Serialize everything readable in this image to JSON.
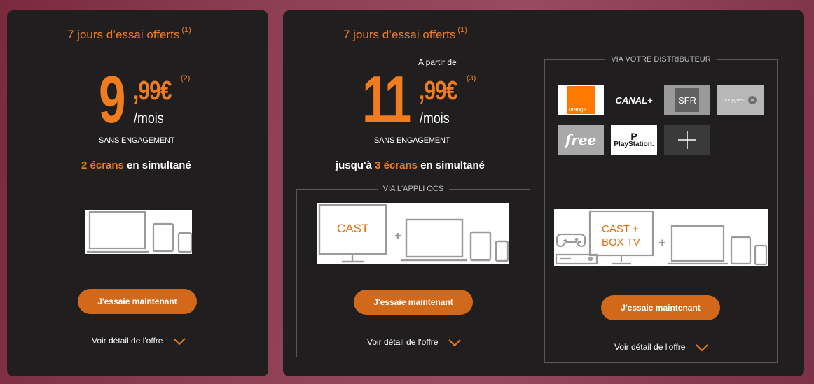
{
  "colors": {
    "accent": "#ef7d20",
    "button": "#d2691a",
    "card": "#201e1f"
  },
  "offer1": {
    "trial": "7 jours d’essai offerts",
    "trial_note": "(1)",
    "price_int": "9",
    "price_cents": ",99€",
    "price_note": "(2)",
    "per_month": "/mois",
    "commitment": "SANS ENGAGEMENT",
    "screens_highlight": "2 écrans",
    "screens_rest": " en simultané",
    "button": "J'essaie maintenant",
    "detail": "Voir détail de l'offre"
  },
  "offer2": {
    "trial": "7 jours d’essai offerts",
    "trial_note": "(1)",
    "from": "A partir de",
    "price_int": "11",
    "price_cents": ",99€",
    "price_note": "(3)",
    "per_month": "/mois",
    "commitment": "SANS ENGAGEMENT",
    "screens_prefix": "jusqu'à ",
    "screens_highlight": "3 écrans",
    "screens_rest": " en simultané",
    "app_group": {
      "label": "VIA L'APPLI OCS",
      "cast_label": "CAST",
      "button": "J'essaie maintenant",
      "detail": "Voir détail de l'offre"
    },
    "distributor_group": {
      "label": "VIA VOTRE DISTRIBUTEUR",
      "logos": {
        "orange": "orange",
        "canal": "CANAL+",
        "sfr": "SFR",
        "bouygues": "bouygues",
        "free": "free",
        "playstation": "PlayStation."
      },
      "cast_box_line1": "CAST +",
      "cast_box_line2": "BOX TV",
      "button": "J'essaie maintenant",
      "detail": "Voir détail de l'offre"
    }
  }
}
